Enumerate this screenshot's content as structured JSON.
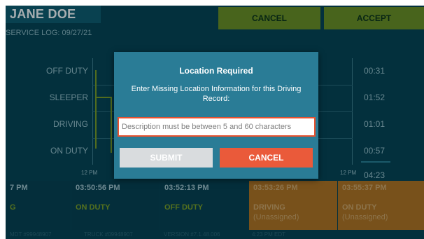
{
  "driver": {
    "name": "JANE DOE"
  },
  "service_log": "SERVICE LOG: 09/27/21",
  "header_buttons": {
    "cancel": "CANCEL",
    "accept": "ACCEPT"
  },
  "graph": {
    "status_labels": [
      "OFF DUTY",
      "SLEEPER",
      "DRIVING",
      "ON DUTY"
    ],
    "totals": [
      "00:31",
      "01:52",
      "01:01",
      "00:57",
      "04:23"
    ],
    "axis_start": "12 PM",
    "axis_end": "12 PM"
  },
  "events": [
    {
      "time": "7 PM",
      "status": "G",
      "sub": "",
      "pending": false
    },
    {
      "time": "03:50:56 PM",
      "status": "ON DUTY",
      "sub": "",
      "pending": false
    },
    {
      "time": "03:52:13 PM",
      "status": "OFF DUTY",
      "sub": "",
      "pending": false
    },
    {
      "time": "03:53:26 PM",
      "status": "DRIVING",
      "sub": "(Unassigned)",
      "pending": true
    },
    {
      "time": "03:55:37 PM",
      "status": "ON DUTY",
      "sub": "(Unassigned)",
      "pending": true
    }
  ],
  "footer": {
    "mdt": "MDT #99948907",
    "truck": "TRUCK #09948907",
    "version": "VERSION #7.1.48.006",
    "time": "4:23 PM EDT"
  },
  "dialog": {
    "title": "Location Required",
    "message": "Enter Missing Location Information for this Driving Record:",
    "input_placeholder": "Description must be between 5 and 60 characters",
    "input_value": "",
    "submit_label": "SUBMIT",
    "cancel_label": "CANCEL"
  },
  "colors": {
    "background": "#05404f",
    "accent_green": "#7f9c1f",
    "pending_orange": "#b8721b",
    "dialog_bg": "#2a7c96",
    "cancel_red": "#ea5a3a"
  }
}
